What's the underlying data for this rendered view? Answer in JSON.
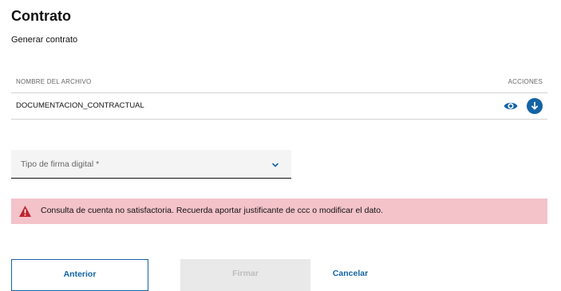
{
  "page": {
    "title": "Contrato",
    "subtitle": "Generar contrato"
  },
  "table": {
    "columns": {
      "name": "NOMBRE DEL ARCHIVO",
      "actions": "ACCIONES"
    },
    "rows": [
      {
        "name": "DOCUMENTACION_CONTRACTUAL",
        "actions": [
          "eye-icon",
          "download-icon"
        ]
      }
    ]
  },
  "signature_select": {
    "label": "Tipo de firma digital *",
    "icon": "chevron-down-icon"
  },
  "alert": {
    "icon": "warning-icon",
    "message": "Consulta de cuenta no satisfactoria. Recuerda aportar justificante de ccc o modificar el dato."
  },
  "buttons": {
    "previous": "Anterior",
    "sign": "Firmar",
    "cancel": "Cancelar"
  },
  "colors": {
    "accent": "#1464a5",
    "alert_background": "#f4c3ca",
    "alert_icon": "#c0262f",
    "disabled_background": "#e9e9e9",
    "disabled_text": "#bdbdbd"
  }
}
